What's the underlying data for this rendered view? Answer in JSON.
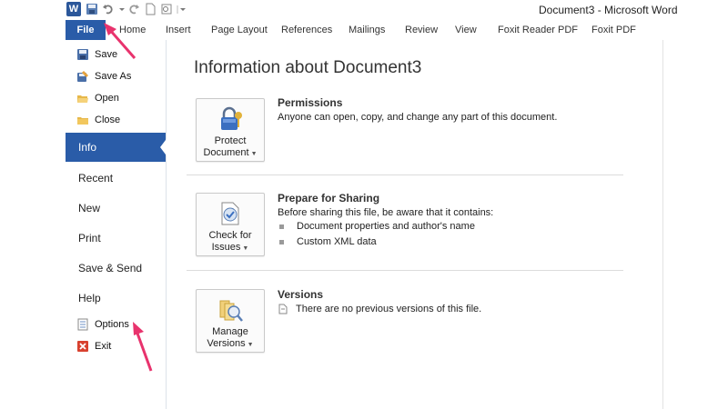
{
  "window": {
    "title": "Document3 - Microsoft Word"
  },
  "quick_access": {
    "icons": [
      "word-logo",
      "save-icon",
      "undo-icon",
      "redo-icon",
      "new-document-icon",
      "print-preview-icon",
      "customize-arrow-icon"
    ],
    "logo_letter": "W"
  },
  "ribbon": {
    "file_tab": "File",
    "tabs": [
      "Home",
      "Insert",
      "Page Layout",
      "References",
      "Mailings",
      "Review",
      "View",
      "Foxit Reader PDF",
      "Foxit PDF"
    ]
  },
  "nav": {
    "save": "Save",
    "save_as": "Save As",
    "open": "Open",
    "close": "Close",
    "info": "Info",
    "recent": "Recent",
    "new": "New",
    "print": "Print",
    "save_send": "Save & Send",
    "help": "Help",
    "options": "Options",
    "exit": "Exit"
  },
  "main": {
    "title": "Information about Document3",
    "permissions": {
      "button_line1": "Protect",
      "button_line2": "Document",
      "title": "Permissions",
      "text": "Anyone can open, copy, and change any part of this document."
    },
    "sharing": {
      "button_line1": "Check for",
      "button_line2": "Issues",
      "title": "Prepare for Sharing",
      "text": "Before sharing this file, be aware that it contains:",
      "bullets": [
        "Document properties and author's name",
        "Custom XML data"
      ]
    },
    "versions": {
      "button_line1": "Manage",
      "button_line2": "Versions",
      "title": "Versions",
      "text": "There are no previous versions of this file."
    }
  },
  "colors": {
    "accent": "#2a5ca8",
    "annotation": "#e8336d"
  }
}
